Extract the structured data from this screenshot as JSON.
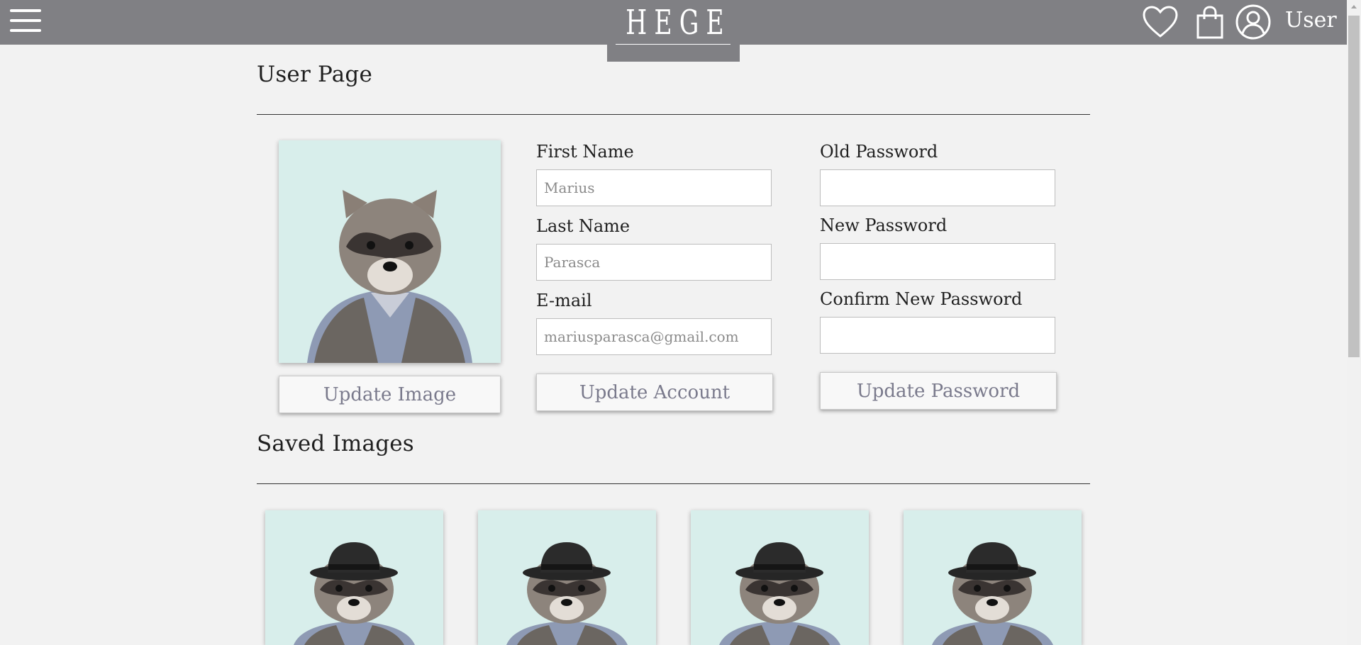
{
  "header": {
    "logo": "HEGE",
    "user_label": "User",
    "icons": [
      "menu-icon",
      "heart-icon",
      "shopping-bag-icon",
      "user-circle-icon"
    ]
  },
  "user_section": {
    "title": "User Page",
    "update_image_label": "Update Image",
    "first_name": {
      "label": "First Name",
      "placeholder": "Marius"
    },
    "last_name": {
      "label": "Last Name",
      "placeholder": "Parasca"
    },
    "email": {
      "label": "E-mail",
      "placeholder": "mariusparasca@gmail.com"
    },
    "update_account_label": "Update Account",
    "old_password": {
      "label": "Old Password",
      "value": ""
    },
    "new_password": {
      "label": "New Password",
      "value": ""
    },
    "confirm_password": {
      "label": "Confirm New Password",
      "value": ""
    },
    "update_password_label": "Update Password"
  },
  "saved_section": {
    "title": "Saved Images",
    "images": [
      "raccoon-with-hat",
      "raccoon-with-hat",
      "raccoon-with-hat",
      "raccoon-with-hat"
    ]
  },
  "colors": {
    "header_bg": "#808084",
    "page_bg": "#f2f2f2",
    "button_text": "#7a7a8c",
    "image_bg": "#d6ecea"
  }
}
